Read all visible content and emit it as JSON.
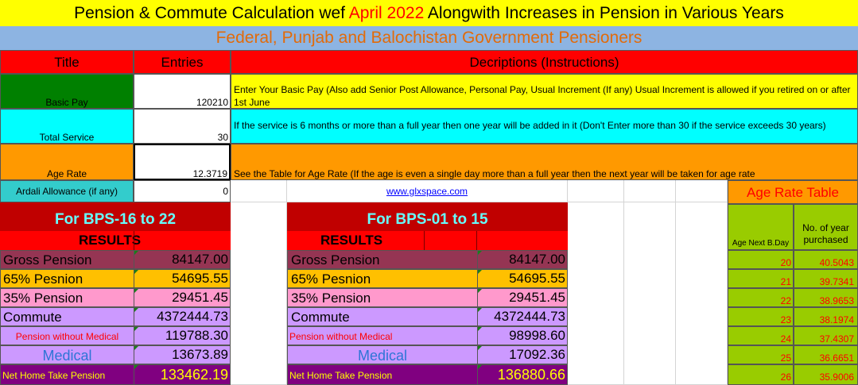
{
  "title": {
    "part1": "Pension & Commute Calculation wef ",
    "highlight": "April 2022",
    "part2": " Alongwith Increases in Pension in Various Years"
  },
  "subtitle": "Federal, Punjab and Balochistan Government Pensioners",
  "headers": {
    "title": "Title",
    "entries": "Entries",
    "descriptions": "Decriptions (Instructions)"
  },
  "inputs": [
    {
      "label": "Basic Pay",
      "value": "120210",
      "desc": "Enter Your Basic Pay (Also add Senior Post Allowance, Personal Pay, Usual Increment (If any) Usual Increment is allowed if you retired on or after 1st June"
    },
    {
      "label": "Total Service",
      "value": "30",
      "desc": "If the service is 6 months or more than a full year then one year will be added in it (Don't Enter more than 30 if the service exceeds 30 years)"
    },
    {
      "label": "Age Rate",
      "value": "12.3719",
      "desc": "See the Table for Age Rate (If the age is even a single day more than a full year then the next year will be taken for age rate"
    },
    {
      "label": "Ardali Allowance (if any)",
      "value": "0"
    }
  ],
  "website": "www.glxspace.com",
  "groupA": {
    "heading": "For BPS-16 to 22",
    "results_label": "RESULTS",
    "rows": [
      {
        "label": "Gross Pension",
        "value": "84147.00"
      },
      {
        "label": "65% Pesnion",
        "value": "54695.55"
      },
      {
        "label": "35% Pension",
        "value": "29451.45"
      },
      {
        "label": "Commute",
        "value": "4372444.73"
      },
      {
        "label": "Pension without Medical",
        "value": "119788.30"
      },
      {
        "label": "Medical",
        "value": "13673.89"
      },
      {
        "label": "Net Home Take Pension",
        "value": "133462.19"
      }
    ]
  },
  "groupB": {
    "heading": "For BPS-01 to 15",
    "results_label": "RESULTS",
    "rows": [
      {
        "label": "Gross Pension",
        "value": "84147.00"
      },
      {
        "label": "65% Pesnion",
        "value": "54695.55"
      },
      {
        "label": "35% Pension",
        "value": "29451.45"
      },
      {
        "label": "Commute",
        "value": "4372444.73"
      },
      {
        "label": "Pension without Medical",
        "value": "98998.60"
      },
      {
        "label": "Medical",
        "value": "17092.36"
      },
      {
        "label": "Net Home Take Pension",
        "value": "136880.66"
      }
    ]
  },
  "age_table": {
    "title": "Age Rate Table",
    "col1": "Age Next B.Day",
    "col2": "No. of year purchased",
    "rows": [
      {
        "age": "20",
        "rate": "40.5043"
      },
      {
        "age": "21",
        "rate": "39.7341"
      },
      {
        "age": "22",
        "rate": "38.9653"
      },
      {
        "age": "23",
        "rate": "38.1974"
      },
      {
        "age": "24",
        "rate": "37.4307"
      },
      {
        "age": "25",
        "rate": "36.6651"
      },
      {
        "age": "26",
        "rate": "35.9006"
      }
    ]
  },
  "colors": {
    "title_bg": "#ffff00",
    "subtitle_bg": "#8db4e2",
    "header_bg": "#ff0000",
    "green": "#008000",
    "cyan": "#00ffff",
    "orange": "#ff9900",
    "teal": "#33cccc",
    "result_head": "#c00000",
    "results_bar": "#ff0000",
    "maroon": "#953553",
    "gold": "#ffc000",
    "pink": "#ff99cc",
    "lilac": "#cc99ff",
    "purple": "#800080",
    "lime": "#99cc00"
  }
}
